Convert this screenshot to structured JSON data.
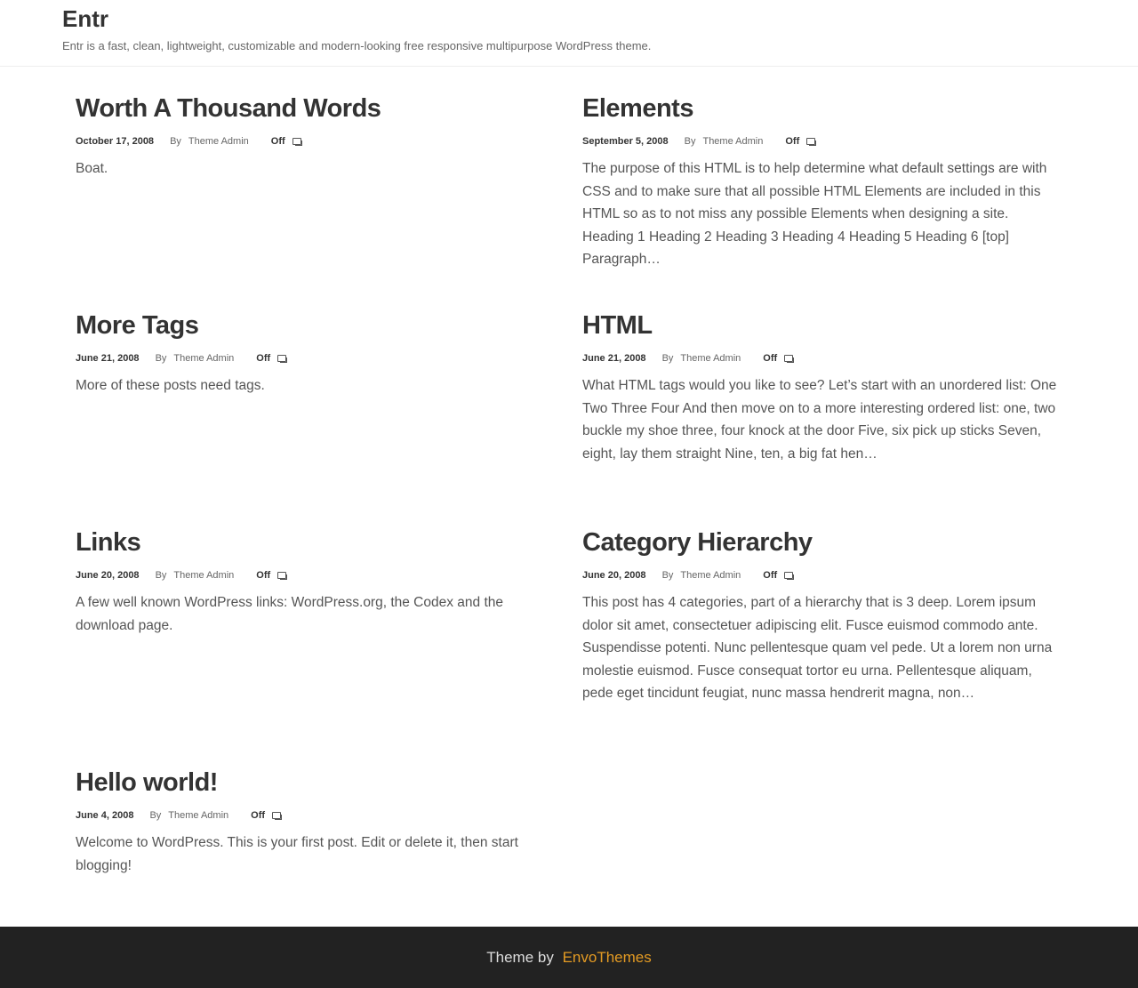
{
  "site": {
    "title": "Entr",
    "description": "Entr is a fast, clean, lightweight, customizable and modern-looking free responsive multipurpose WordPress theme."
  },
  "posts": [
    {
      "title": "Worth A Thousand Words",
      "date": "October 17, 2008",
      "by": "By",
      "author": "Theme Admin",
      "comments": "Off",
      "excerpt": "Boat."
    },
    {
      "title": "Elements",
      "date": "September 5, 2008",
      "by": "By",
      "author": "Theme Admin",
      "comments": "Off",
      "excerpt": "The purpose of this HTML is to help determine what default settings are with CSS and to make sure that all possible HTML Elements are included in this HTML so as to not miss any possible Elements when designing a site. Heading 1 Heading 2 Heading 3 Heading 4 Heading 5 Heading 6 [top] Paragraph…"
    },
    {
      "title": "More Tags",
      "date": "June 21, 2008",
      "by": "By",
      "author": "Theme Admin",
      "comments": "Off",
      "excerpt": "More of these posts need tags."
    },
    {
      "title": "HTML",
      "date": "June 21, 2008",
      "by": "By",
      "author": "Theme Admin",
      "comments": "Off",
      "excerpt": "What HTML tags would you like to see? Let’s start with an unordered list: One Two Three Four And then move on to a more interesting ordered list: one, two buckle my shoe three, four knock at the door Five, six pick up sticks Seven, eight, lay them straight Nine, ten, a big fat hen…"
    },
    {
      "title": "Links",
      "date": "June 20, 2008",
      "by": "By",
      "author": "Theme Admin",
      "comments": "Off",
      "excerpt": "A few well known WordPress links: WordPress.org, the Codex and the download page."
    },
    {
      "title": "Category Hierarchy",
      "date": "June 20, 2008",
      "by": "By",
      "author": "Theme Admin",
      "comments": "Off",
      "excerpt": "This post has 4 categories, part of a hierarchy that is 3 deep. Lorem ipsum dolor sit amet, consectetuer adipiscing elit. Fusce euismod commodo ante. Suspendisse potenti. Nunc pellentesque quam vel pede. Ut a lorem non urna molestie euismod. Fusce consequat tortor eu urna. Pellentesque aliquam, pede eget tincidunt feugiat, nunc massa hendrerit magna, non…"
    },
    {
      "title": "Hello world!",
      "date": "June 4, 2008",
      "by": "By",
      "author": "Theme Admin",
      "comments": "Off",
      "excerpt": "Welcome to WordPress. This is your first post. Edit or delete it, then start blogging!"
    }
  ],
  "footer": {
    "prefix": "Theme by",
    "link_label": "EnvoThemes"
  },
  "colors": {
    "footer_bg": "#222222",
    "footer_link": "#e39a23",
    "title_text": "#333333"
  }
}
